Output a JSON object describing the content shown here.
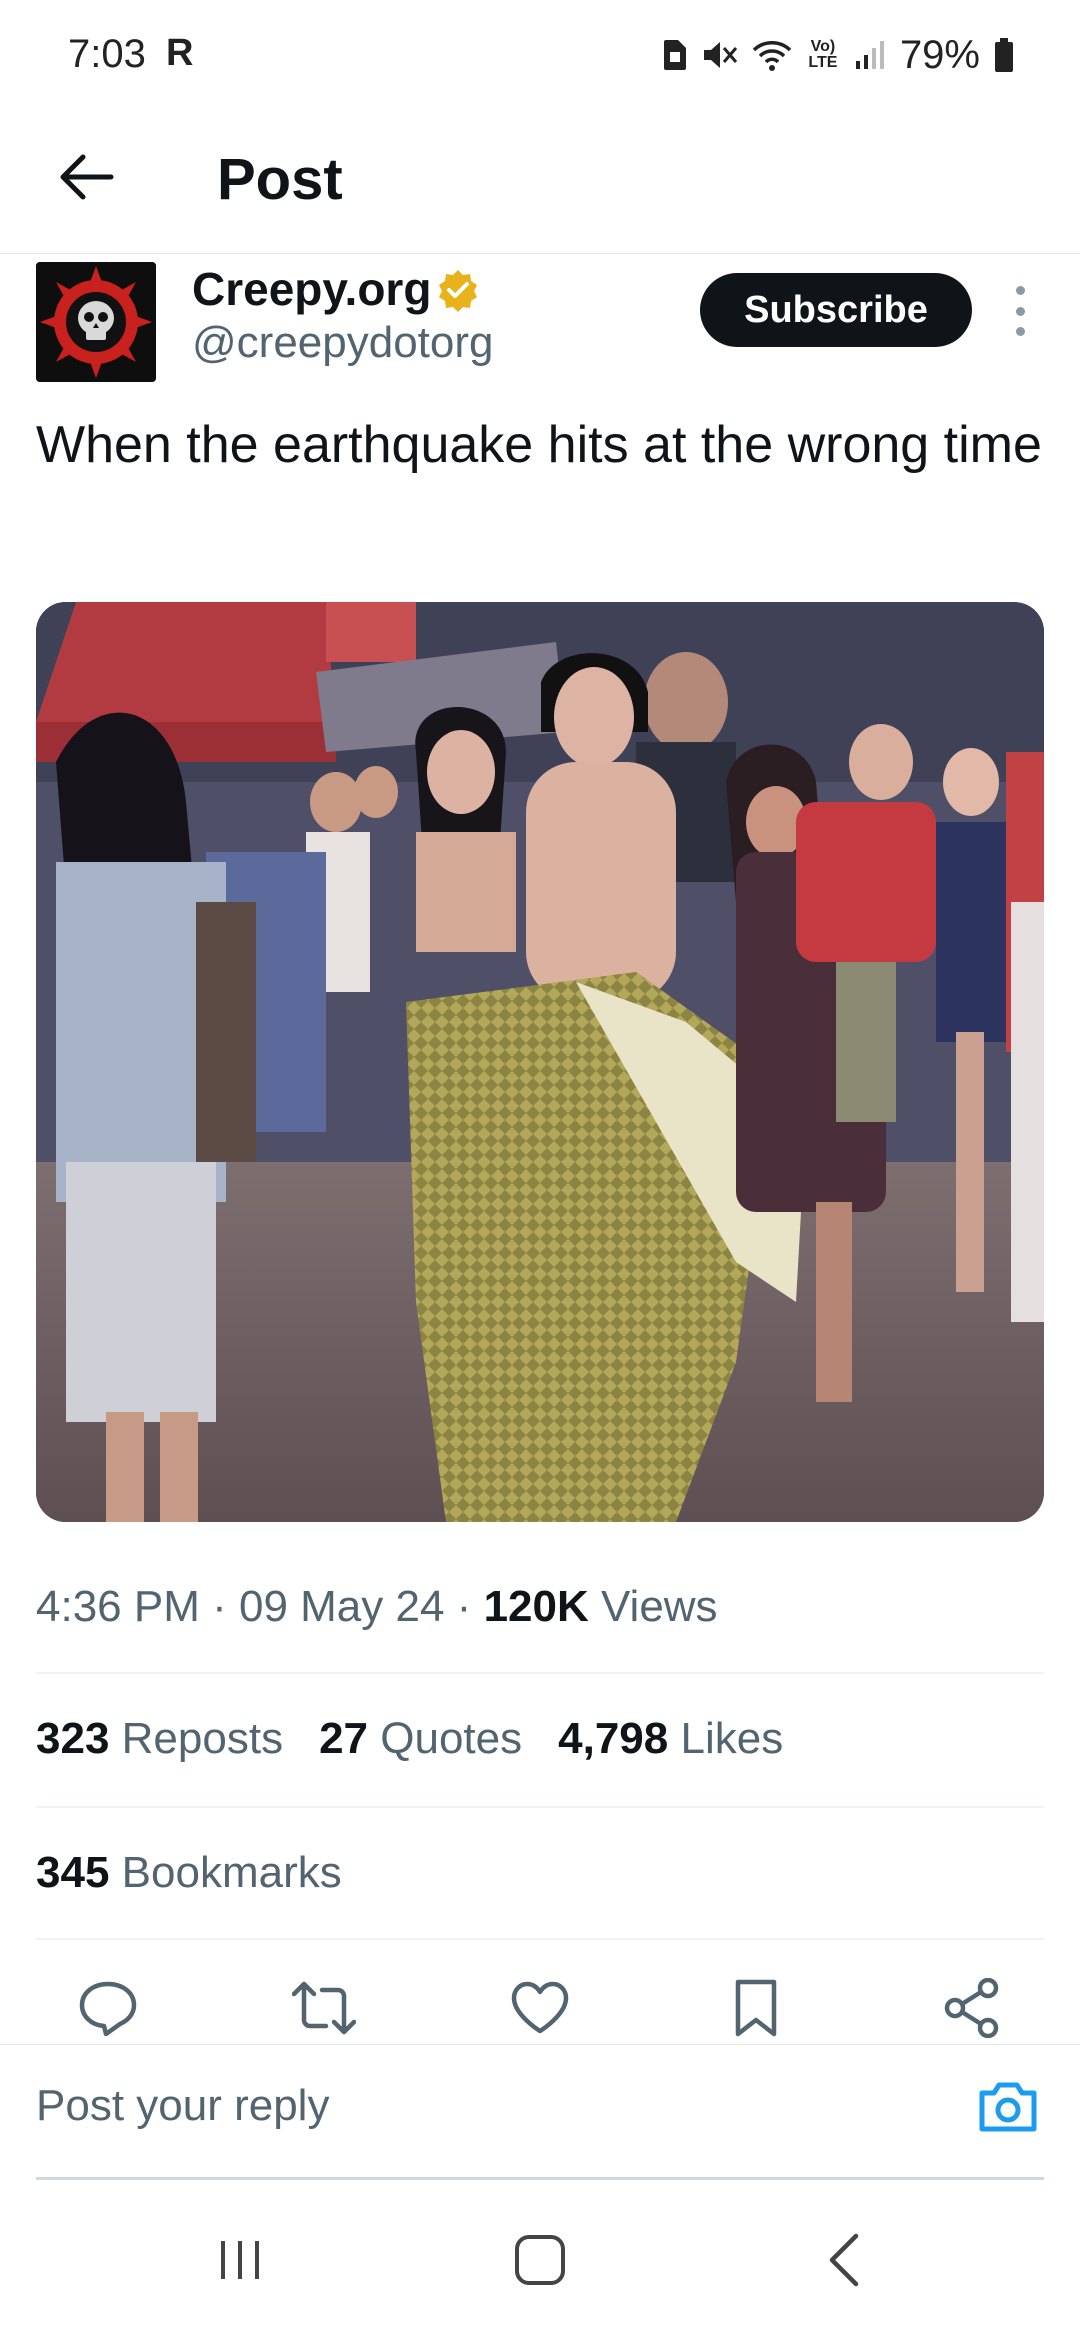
{
  "status_bar": {
    "time": "7:03",
    "carrier_badge": "R",
    "battery_percent": "79%",
    "network_label": "Vo) LTE"
  },
  "header": {
    "title": "Post"
  },
  "author": {
    "name": "Creepy.org",
    "handle": "@creepydotorg",
    "verified_color": "#e8b21d",
    "subscribe_label": "Subscribe"
  },
  "tweet": {
    "text": "When the earthquake hits at the wrong time"
  },
  "meta": {
    "time": "4:36 PM",
    "date": "09 May 24",
    "views_count": "120K",
    "views_label": "Views"
  },
  "stats": {
    "reposts_count": "323",
    "reposts_label": "Reposts",
    "quotes_count": "27",
    "quotes_label": "Quotes",
    "likes_count": "4,798",
    "likes_label": "Likes",
    "bookmarks_count": "345",
    "bookmarks_label": "Bookmarks"
  },
  "actions": [
    "reply-icon",
    "repost-icon",
    "like-icon",
    "bookmark-icon",
    "share-icon"
  ],
  "reply": {
    "placeholder": "Post your reply",
    "accent_color": "#1d9bf0"
  },
  "navigation": [
    "recents-icon",
    "home-icon",
    "back-icon"
  ]
}
